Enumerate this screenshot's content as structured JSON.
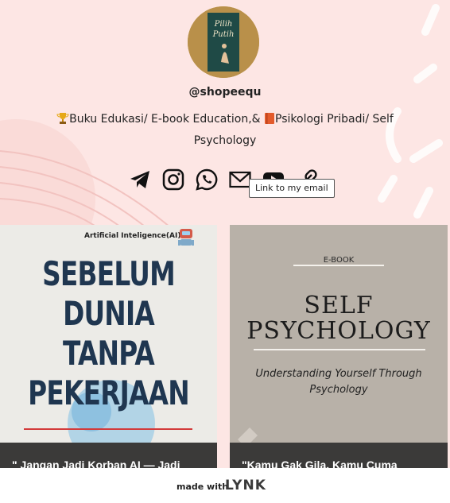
{
  "profile": {
    "avatar_alt": "Pilih Putih book cover",
    "handle": "@shopeequ",
    "bio": {
      "icon1": "trophy-icon",
      "text1": "Buku Edukasi/ E-book Education,&",
      "icon2": "book-icon",
      "text2": "Psikologi Pribadi/ Self Psychology"
    }
  },
  "socials": [
    {
      "name": "telegram-icon"
    },
    {
      "name": "instagram-icon"
    },
    {
      "name": "whatsapp-icon"
    },
    {
      "name": "email-icon"
    },
    {
      "name": "youtube-icon"
    },
    {
      "name": "link-icon"
    }
  ],
  "tooltip": "Link to my email",
  "cards": [
    {
      "tag": "Artificial Inteligence(AI)",
      "cover_lines": [
        "SEBELUM",
        "DUNIA",
        "TANPA",
        "PEKERJAAN"
      ],
      "title": "\" Jangan Jadi Korban AI — Jadi"
    },
    {
      "ebook_label": "E-BOOK",
      "cover_title_1": "SELF",
      "cover_title_2": "PSYCHOLOGY",
      "cover_sub": "Understanding Yourself Through Psychology",
      "title": "\"Kamu Gak Gila, Kamu Cuma"
    }
  ],
  "footer": {
    "made_with": "made with",
    "logo": "LYNK"
  },
  "colors": {
    "background": "#fde6e4",
    "cover_blue": "#1f3650",
    "card_title_bar": "#3b3a39"
  }
}
